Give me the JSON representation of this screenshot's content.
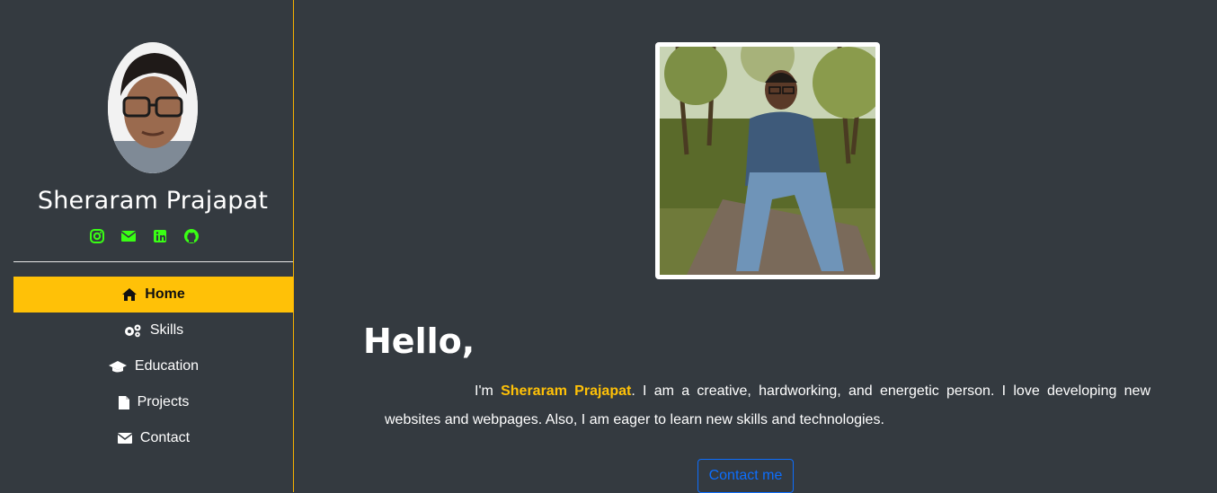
{
  "profile": {
    "name": "Sheraram Prajapat"
  },
  "socials": [
    {
      "icon": "instagram-icon"
    },
    {
      "icon": "mail-icon"
    },
    {
      "icon": "linkedin-icon"
    },
    {
      "icon": "github-icon"
    }
  ],
  "nav": {
    "items": [
      {
        "label": "Home",
        "icon": "home-icon",
        "active": true
      },
      {
        "label": "Skills",
        "icon": "gears-icon"
      },
      {
        "label": "Education",
        "icon": "graduation-cap-icon"
      },
      {
        "label": "Projects",
        "icon": "file-icon"
      },
      {
        "label": "Contact",
        "icon": "envelope-icon"
      }
    ]
  },
  "main": {
    "hello": "Hello,",
    "intro_prefix": "I'm ",
    "intro_name": "Sheraram Prajapat",
    "intro_rest": ". I am a creative, hardworking, and energetic person. I love developing new websites and webpages. Also, I am eager to learn new skills and technologies.",
    "contact_button": "Contact me"
  },
  "colors": {
    "background": "#343a40",
    "accent": "#ffc107",
    "social": "#39ff14",
    "button": "#0d6efd"
  }
}
